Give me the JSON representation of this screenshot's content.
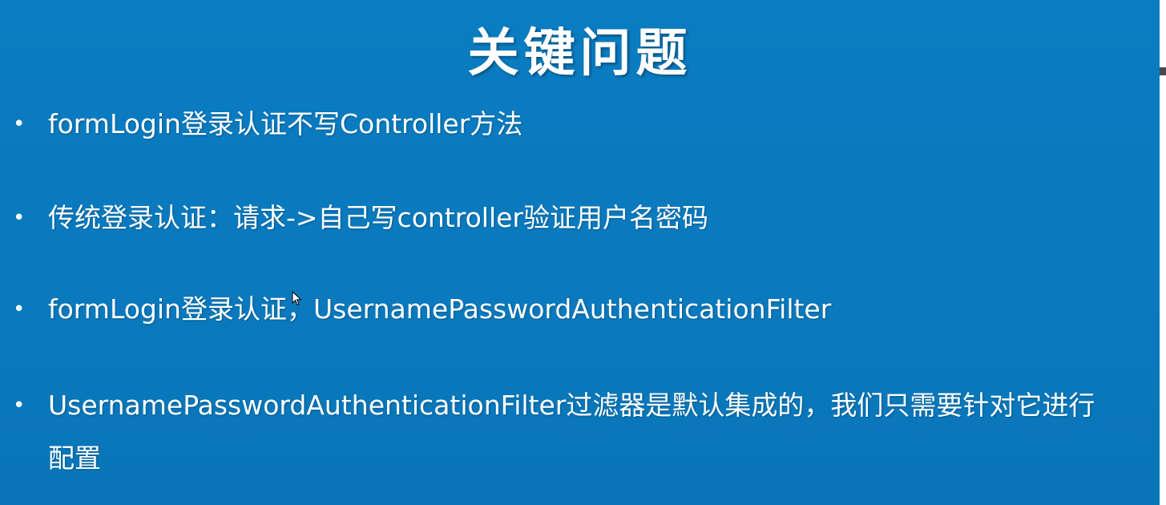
{
  "slide": {
    "title": "关键问题",
    "bullets": [
      {
        "marker": "•",
        "text": "formLogin登录认证不写Controller方法"
      },
      {
        "marker": "•",
        "text": "传统登录认证：请求->自己写controller验证用户名密码"
      },
      {
        "marker": "•",
        "text": "formLogin登录认证，UsernamePasswordAuthenticationFilter"
      },
      {
        "marker": "•",
        "text": "UsernamePasswordAuthenticationFilter过滤器是默认集成的，我们只需要针对它进行配置"
      }
    ]
  },
  "colors": {
    "background": "#0a7cc1",
    "text": "#ffffff"
  },
  "icons": {
    "cursor": "mouse-pointer-icon"
  }
}
